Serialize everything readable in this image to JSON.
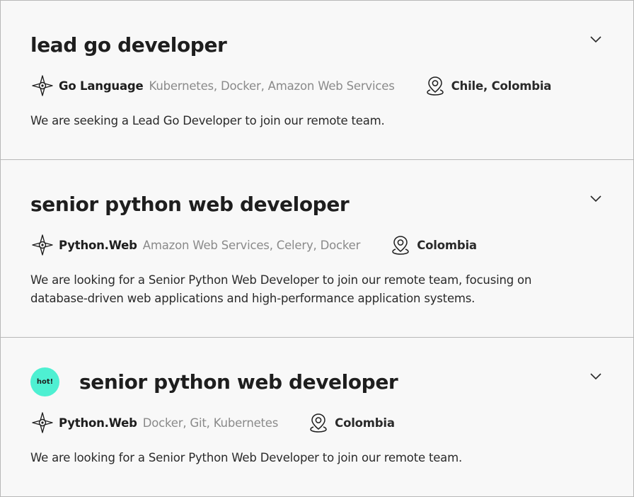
{
  "jobs": [
    {
      "title": "lead go developer",
      "primary_skill": "Go Language",
      "other_skills": "Kubernetes, Docker, Amazon Web Services",
      "location": "Chile, Colombia",
      "description": "We are seeking a Lead Go Developer to join our remote team.",
      "hot": false
    },
    {
      "title": "senior python web developer",
      "primary_skill": "Python.Web",
      "other_skills": "Amazon Web Services, Celery, Docker",
      "location": "Colombia",
      "description": "We are looking for a Senior Python Web Developer to join our remote team, focusing on database-driven web applications and high-performance application systems.",
      "hot": false
    },
    {
      "title": "senior python web developer",
      "primary_skill": "Python.Web",
      "other_skills": "Docker, Git, Kubernetes",
      "location": "Colombia",
      "description": "We are looking for a Senior Python Web Developer to join our remote team.",
      "hot": true,
      "badge": "hot!"
    }
  ],
  "colors": {
    "background": "#f8f8f8",
    "divider": "#b8b8b8",
    "hot_badge": "#4ef0d2",
    "muted_text": "#8a8a8a",
    "text": "#1e1e1e"
  },
  "icons": {
    "skill": "compass-star-icon",
    "location": "map-pin-icon",
    "expand": "chevron-down-icon"
  }
}
